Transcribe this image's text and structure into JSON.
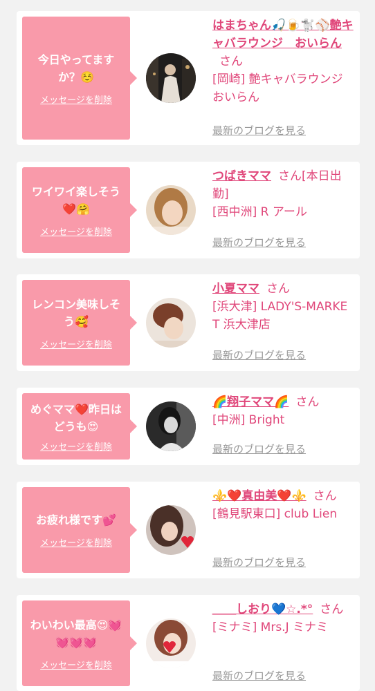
{
  "delete_label": "メッセージを削除",
  "blog_label": "最新のブログを見る",
  "san_label": "さん",
  "items": [
    {
      "message": "今日やってますか？☺️",
      "name": "はまちゃん🎣🍺🐩⚾️艶キャバラウンジ　おいらん",
      "shop": "[岡崎] 艶キャバラウンジ おいらん"
    },
    {
      "message": "ワイワイ楽しそう❤️🤗",
      "name": "つばきママ",
      "name_suffix": "さん[本日出勤]",
      "shop": "[西中洲] R アール"
    },
    {
      "message": "レンコン美味しそう🥰",
      "name": "小夏ママ",
      "shop": "[浜大津] LADY'S-MARKET 浜大津店"
    },
    {
      "message": "めぐママ❤️昨日はどうも😍",
      "name": "🌈翔子ママ🌈",
      "shop": "[中洲] Bright"
    },
    {
      "message": "お疲れ様です💕",
      "name": "⚜️❤️真由美❤️⚜️",
      "shop": "[鶴見駅東口] club Lien"
    },
    {
      "message": "わいわい最高😍💓💓💓💓",
      "name": "＿＿しおり💙☆.*°",
      "shop": "[ミナミ] Mrs.J ミナミ"
    }
  ],
  "colors": {
    "background": "#f2f2f2",
    "card": "#ffffff",
    "bubble": "#f99aaa",
    "name_text": "#e0477a",
    "blog_link": "#999999"
  }
}
